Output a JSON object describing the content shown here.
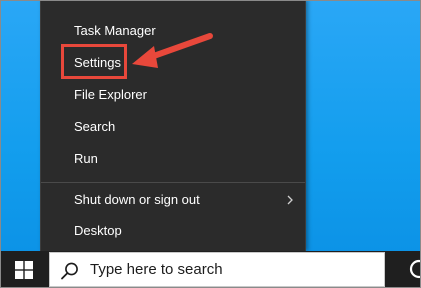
{
  "menu": {
    "items": [
      {
        "label": "Task Manager"
      },
      {
        "label": "Settings"
      },
      {
        "label": "File Explorer"
      },
      {
        "label": "Search"
      },
      {
        "label": "Run"
      },
      {
        "label": "Shut down or sign out",
        "has_submenu": true
      },
      {
        "label": "Desktop"
      }
    ]
  },
  "annotation": {
    "highlight_color": "#e8483b",
    "target": "Settings"
  },
  "taskbar": {
    "start_icon": "windows-logo-icon",
    "search_icon": "search-icon",
    "search_placeholder": "Type here to search",
    "cortana_icon": "cortana-circle-icon"
  },
  "colors": {
    "menu_bg": "#2b2b2b",
    "taskbar_bg": "#1f1f1f",
    "desktop_bg": "#129ded"
  }
}
